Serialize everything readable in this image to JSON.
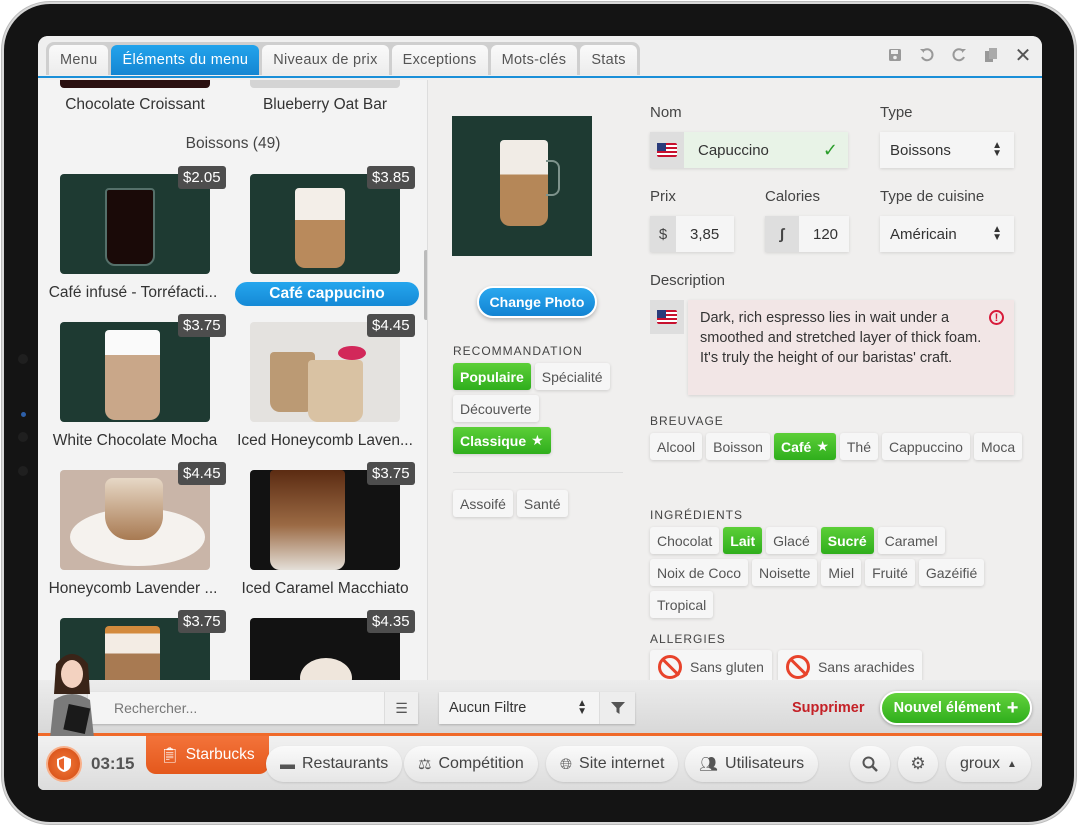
{
  "tabs": [
    {
      "label": "Menu",
      "active": false
    },
    {
      "label": "Éléments du menu",
      "active": true
    },
    {
      "label": "Niveaux de prix",
      "active": false
    },
    {
      "label": "Exceptions",
      "active": false
    },
    {
      "label": "Mots-clés",
      "active": false
    },
    {
      "label": "Stats",
      "active": false
    }
  ],
  "toolbar": {
    "icons": [
      "save-icon",
      "undo-icon",
      "redo-icon",
      "copy-icon",
      "close-icon"
    ]
  },
  "list": {
    "prev_items": [
      "Chocolate Croissant",
      "Blueberry Oat Bar"
    ],
    "category_title": "Boissons (49)",
    "items": [
      {
        "name": "Café infusé - Torréfacti...",
        "price": "$2.05",
        "selected": false
      },
      {
        "name": "Café cappucino",
        "price": "$3.85",
        "selected": true
      },
      {
        "name": "White Chocolate Mocha",
        "price": "$3.75",
        "selected": false
      },
      {
        "name": "Iced Honeycomb Laven...",
        "price": "$4.45",
        "selected": false
      },
      {
        "name": "Honeycomb Lavender ...",
        "price": "$4.45",
        "selected": false
      },
      {
        "name": "Iced Caramel Macchiato",
        "price": "$3.75",
        "selected": false
      },
      {
        "name": "",
        "price": "$3.75",
        "selected": false
      },
      {
        "name": "",
        "price": "$4.35",
        "selected": false
      }
    ]
  },
  "detail": {
    "change_photo": "Change Photo",
    "recommandation_label": "RECOMMANDATION",
    "recommandation": [
      {
        "label": "Populaire",
        "on": true,
        "star": false
      },
      {
        "label": "Spécialité",
        "on": false,
        "star": false
      },
      {
        "label": "Découverte",
        "on": false,
        "star": false
      },
      {
        "label": "Classique",
        "on": true,
        "star": true
      }
    ],
    "moods": [
      {
        "label": "Assoifé",
        "on": false
      },
      {
        "label": "Santé",
        "on": false
      }
    ]
  },
  "form": {
    "nom_label": "Nom",
    "nom_value": "Capuccino",
    "type_label": "Type",
    "type_value": "Boissons",
    "prix_label": "Prix",
    "prix_prefix": "$",
    "prix_value": "3,85",
    "calories_label": "Calories",
    "calories_value": "120",
    "cuisine_label": "Type de cuisine",
    "cuisine_value": "Américain",
    "description_label": "Description",
    "description_value": "Dark, rich espresso lies in wait under a smoothed and stretched layer of thick foam. It's truly the height of our baristas' craft.",
    "breuvage_label": "BREUVAGE",
    "breuvage": [
      {
        "label": "Alcool",
        "on": false,
        "star": false
      },
      {
        "label": "Boisson",
        "on": false,
        "star": false
      },
      {
        "label": "Café",
        "on": true,
        "star": true
      },
      {
        "label": "Thé",
        "on": false,
        "star": false
      },
      {
        "label": "Cappuccino",
        "on": false,
        "star": false
      },
      {
        "label": "Moca",
        "on": false,
        "star": false
      }
    ],
    "ingredients_label": "INGRÉDIENTS",
    "ingredients": [
      {
        "label": "Chocolat",
        "on": false
      },
      {
        "label": "Lait",
        "on": true
      },
      {
        "label": "Glacé",
        "on": false
      },
      {
        "label": "Sucré",
        "on": true
      },
      {
        "label": "Caramel",
        "on": false
      },
      {
        "label": "Noix de Coco",
        "on": false
      },
      {
        "label": "Noisette",
        "on": false
      },
      {
        "label": "Miel",
        "on": false
      },
      {
        "label": "Fruité",
        "on": false
      },
      {
        "label": "Gazéifié",
        "on": false
      },
      {
        "label": "Tropical",
        "on": false
      }
    ],
    "allergies_label": "ALLERGIES",
    "allergies": [
      {
        "label": "Sans gluten"
      },
      {
        "label": "Sans arachides"
      }
    ]
  },
  "actions": {
    "search_placeholder": "Rechercher...",
    "filter_value": "Aucun Filtre",
    "delete_label": "Supprimer",
    "new_label": "Nouvel élément"
  },
  "nav": {
    "time": "03:15",
    "active_restaurant": "Starbucks",
    "items": [
      "Restaurants",
      "Compétition",
      "Site internet",
      "Utilisateurs"
    ],
    "user": "groux"
  },
  "colors": {
    "accent_blue": "#1a8fd8",
    "accent_green": "#3dbd26",
    "accent_orange": "#f06a2a",
    "danger_red": "#c42127"
  }
}
